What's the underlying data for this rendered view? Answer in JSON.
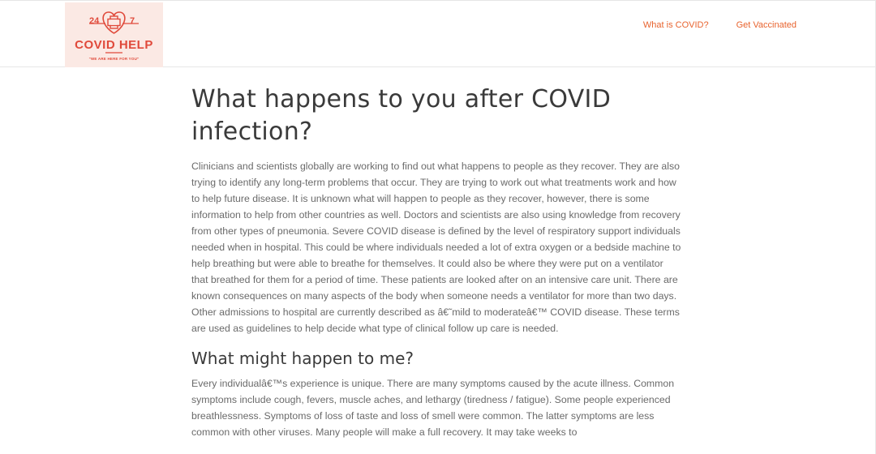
{
  "logo": {
    "num_left": "24",
    "num_right": "7",
    "title": "COVID HELP",
    "tagline": "\"WE ARE HERE FOR YOU\"",
    "icon": "heart-cross-icon",
    "color": "#e04a3b"
  },
  "nav": {
    "items": [
      {
        "label": "What is COVID?"
      },
      {
        "label": "Get Vaccinated"
      }
    ],
    "color": "#e8632e"
  },
  "article": {
    "title": "What happens to you after COVID infection?",
    "paragraph1": "Clinicians and scientists globally are working to find out what happens to people as they recover. They are also trying to identify any long-term problems that occur. They are trying to work out what treatments work and how to help future disease. It is unknown what will happen to people as they recover, however, there is some information to help from other countries as well. Doctors and scientists are also using knowledge from recovery from other types of pneumonia. Severe COVID disease is defined by the level of respiratory support individuals needed when in hospital. This could be where individuals needed a lot of extra oxygen or a bedside machine to help breathing but were able to breathe for themselves. It could also be where they were put on a ventilator that breathed for them for a period of time. These patients are looked after on an intensive care unit. There are known consequences on many aspects of the body when someone needs a ventilator for more than two days. Other admissions to hospital are currently described as â€˜mild to moderateâ€™ COVID disease. These terms are used as guidelines to help decide what type of clinical follow up care is needed.",
    "subheading": "What might happen to me?",
    "paragraph2": "Every individualâ€™s experience is unique. There are many symptoms caused by the acute illness. Common symptoms include cough, fevers, muscle aches, and lethargy (tiredness / fatigue). Some people experienced breathlessness. Symptoms of loss of taste and loss of smell were common. The latter symptoms are less common with other viruses. Many people will make a full recovery. It may take weeks to"
  }
}
